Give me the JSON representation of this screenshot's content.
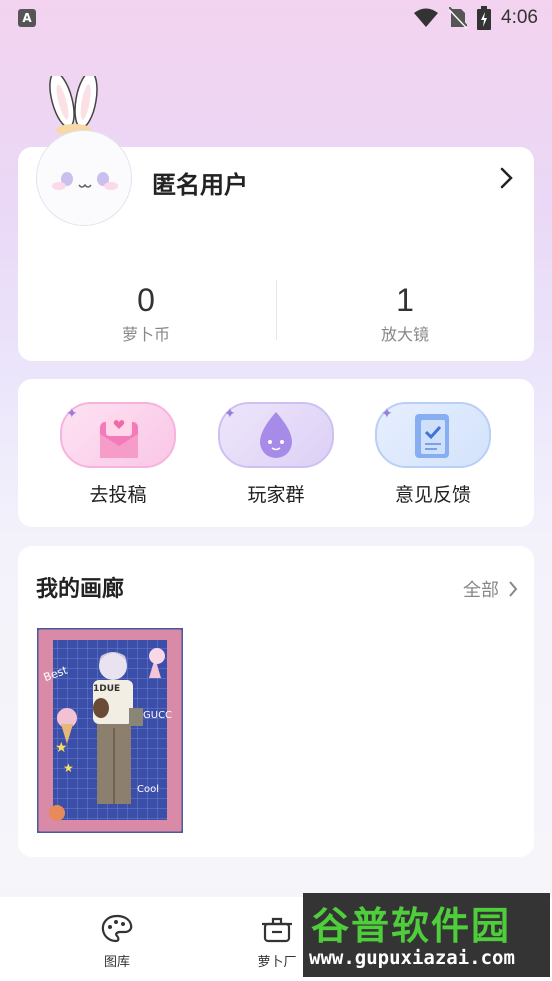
{
  "status_bar": {
    "time": "4:06",
    "left_badge": "A"
  },
  "profile": {
    "username": "匿名用户",
    "stats": [
      {
        "value": "0",
        "label": "萝卜币"
      },
      {
        "value": "1",
        "label": "放大镜"
      }
    ]
  },
  "quick_actions": [
    {
      "label": "去投稿",
      "icon": "submit-mail-icon"
    },
    {
      "label": "玩家群",
      "icon": "chat-bubble-icon"
    },
    {
      "label": "意见反馈",
      "icon": "feedback-clipboard-icon"
    }
  ],
  "gallery": {
    "title": "我的画廊",
    "all_label": "全部",
    "items": [
      {
        "text": [
          "1DUE",
          "Best",
          "GUCC",
          "Cool"
        ]
      }
    ]
  },
  "bottom_nav": [
    {
      "label": "图库",
      "icon": "palette-icon"
    },
    {
      "label": "萝卜厂",
      "icon": "pot-icon"
    }
  ],
  "watermark": {
    "title": "谷普软件园",
    "url": "www.gupuxiazai.com"
  },
  "colors": {
    "pink_pill": "#fbd6ee",
    "purple_pill": "#e6dcf8",
    "blue_pill": "#dbe7fb",
    "watermark_green": "#4fce3c"
  }
}
